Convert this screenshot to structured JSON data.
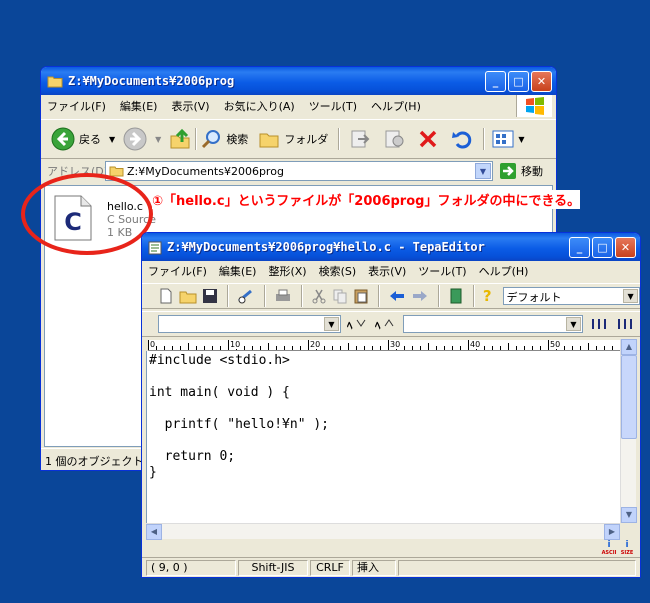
{
  "explorer": {
    "title": "Z:¥MyDocuments¥2006prog",
    "menu": [
      "ファイル(F)",
      "編集(E)",
      "表示(V)",
      "お気に入り(A)",
      "ツール(T)",
      "ヘルプ(H)"
    ],
    "back_label": "戻る",
    "search_label": "検索",
    "folders_label": "フォルダ",
    "address_label": "アドレス(D)",
    "address_value": "Z:¥MyDocuments¥2006prog",
    "go_label": "移動",
    "file": {
      "name": "hello.c",
      "type": "C Source",
      "size": "1 KB"
    },
    "status": "1 個のオブジェクト"
  },
  "annotation": "①「hello.c」というファイルが「2006prog」フォルダの中にできる。",
  "editor": {
    "title": "Z:¥MyDocuments¥2006prog¥hello.c - TepaEditor",
    "menu": [
      "ファイル(F)",
      "編集(E)",
      "整形(X)",
      "検索(S)",
      "表示(V)",
      "ツール(T)",
      "ヘルプ(H)"
    ],
    "font_combo": "デフォルト",
    "ruler": [
      "0",
      "10",
      "20",
      "30",
      "40",
      "50"
    ],
    "code_lines": [
      "#include <stdio.h>",
      "",
      "int main( void ) {",
      "",
      "  printf( \"hello!¥n\" );",
      "",
      "  return 0;",
      "}"
    ],
    "status": {
      "position": "( 9, 0 )",
      "encoding": "Shift-JIS",
      "newline": "CRLF",
      "mode": "挿入"
    },
    "corner_icons": [
      "ASCII",
      "SIZE"
    ]
  },
  "colors": {
    "desktop": "#0a4699",
    "titlebar": "#0b5ce6",
    "annotation": "#ff0000",
    "circle": "#e8241a"
  }
}
